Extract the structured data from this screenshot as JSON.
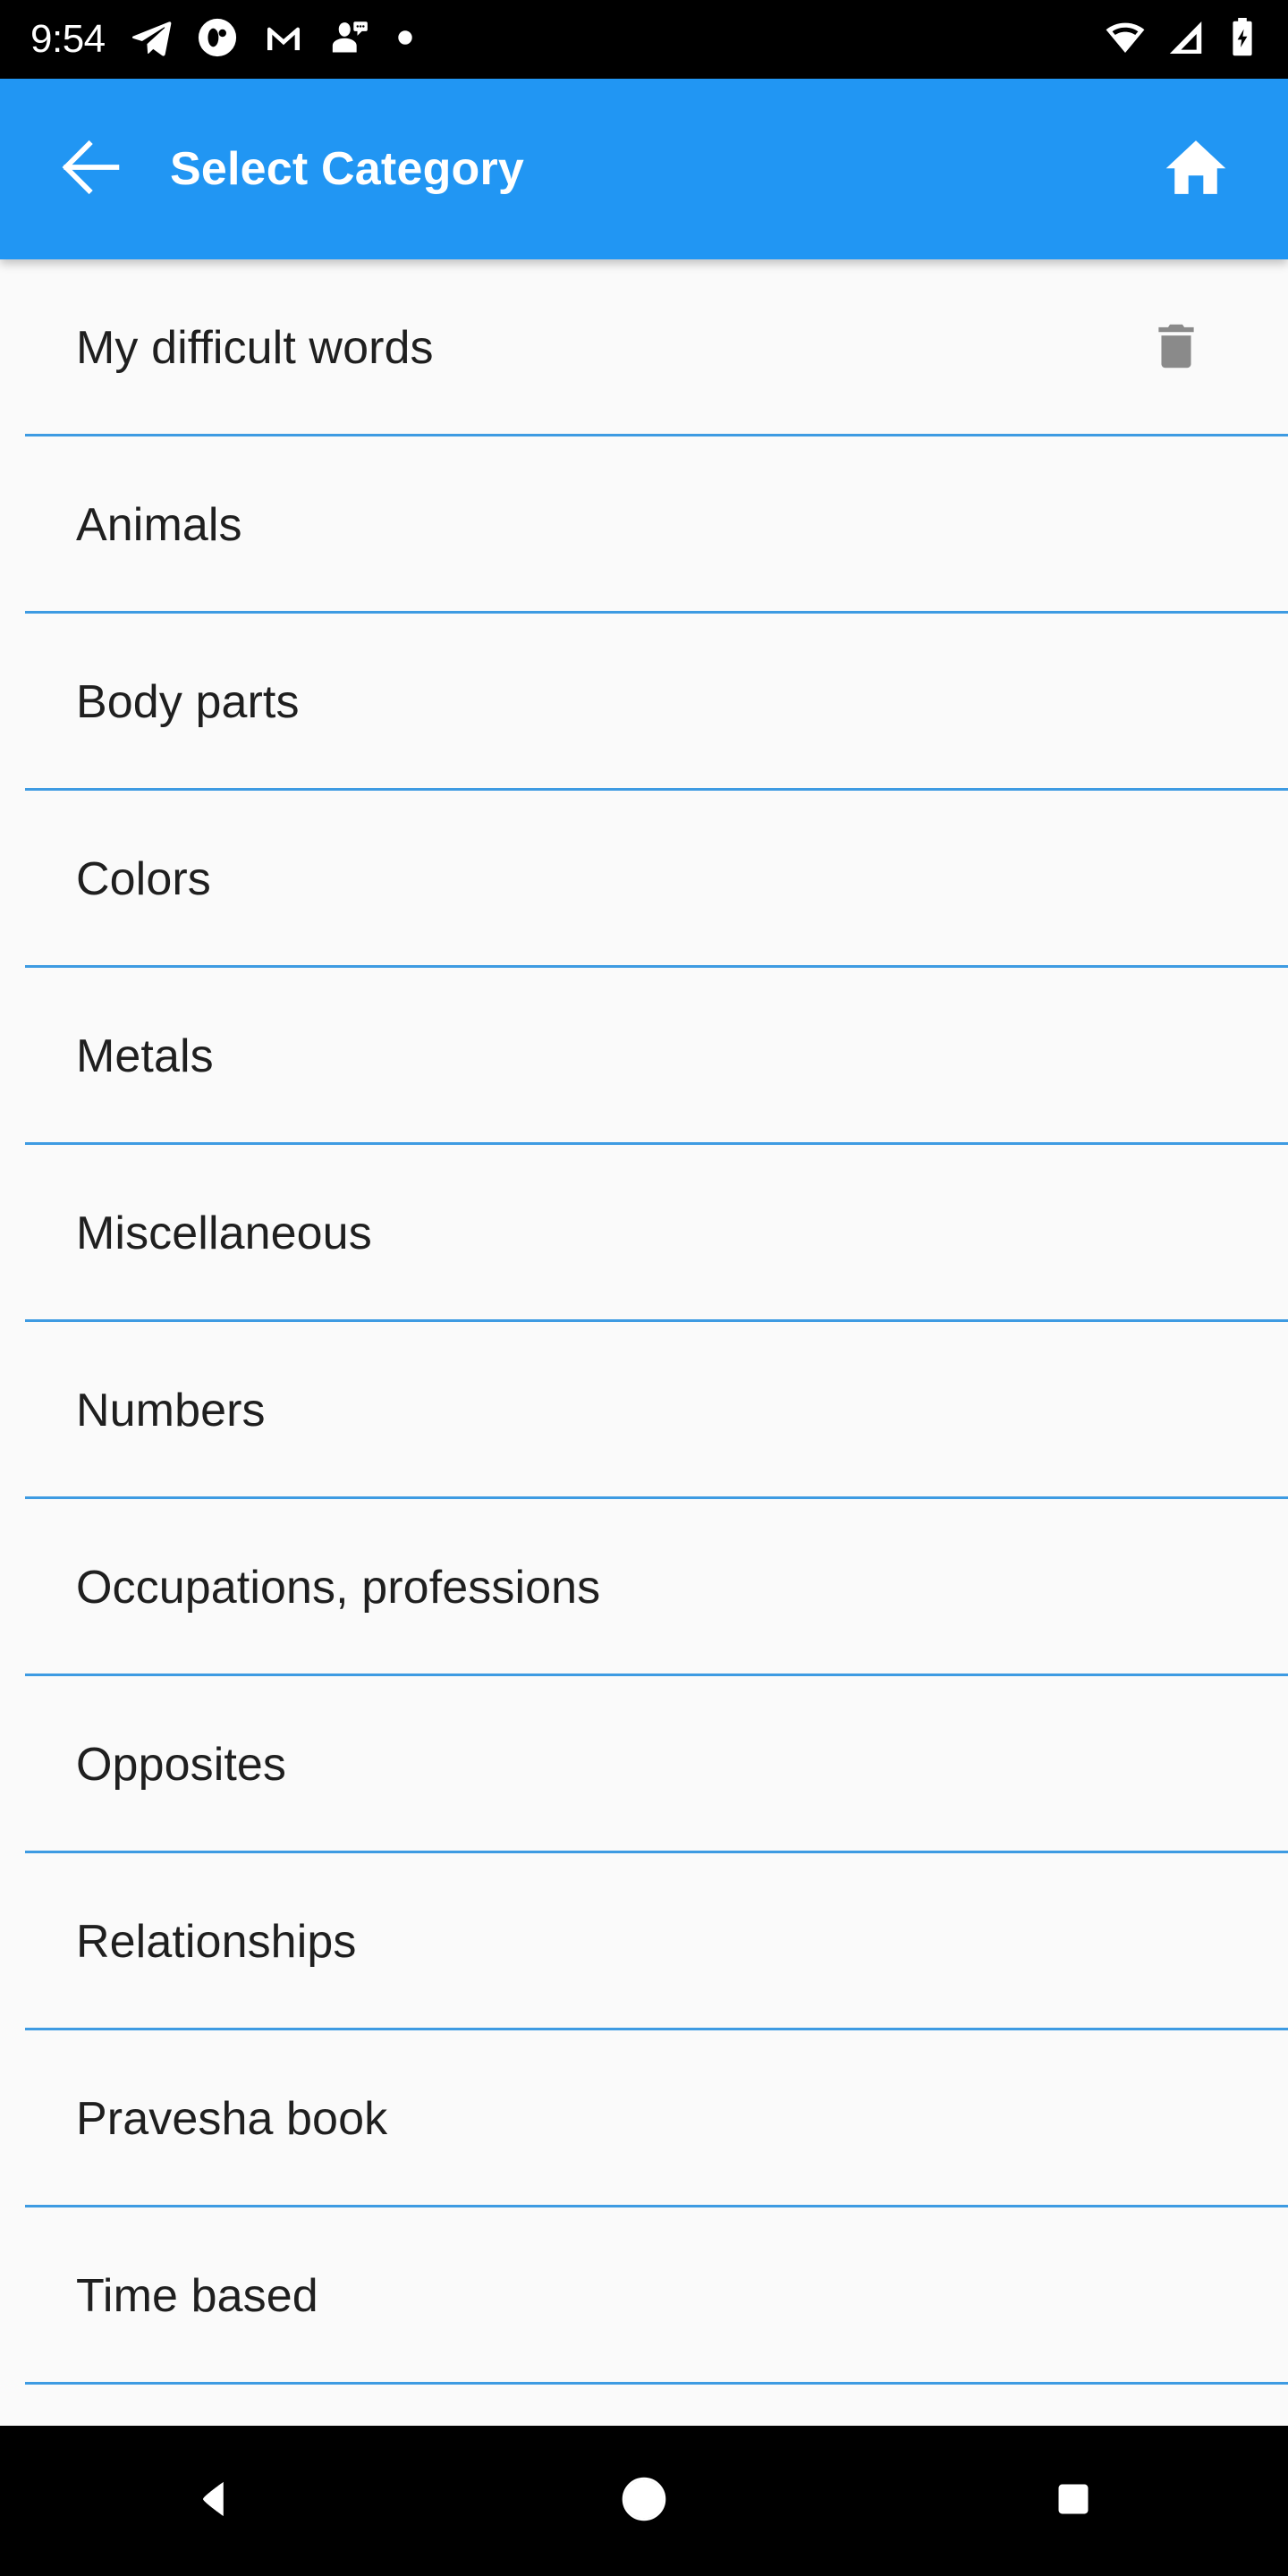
{
  "status_bar": {
    "time": "9:54",
    "notification_icons": [
      {
        "name": "telegram-icon"
      },
      {
        "name": "app-notification-icon"
      },
      {
        "name": "gmail-icon"
      },
      {
        "name": "chat-person-icon"
      },
      {
        "name": "more-notifications-dot-icon"
      }
    ],
    "system_icons": [
      {
        "name": "wifi-icon"
      },
      {
        "name": "cellular-signal-icon"
      },
      {
        "name": "battery-charging-icon"
      }
    ],
    "background_color": "#000000",
    "foreground_color": "#FFFFFF"
  },
  "app_bar": {
    "title": "Select Category",
    "back_icon": "arrow-back-icon",
    "home_icon": "home-icon",
    "background_color": "#2196F3",
    "foreground_color": "#FFFFFF"
  },
  "list": {
    "background_color": "#FAFAFA",
    "divider_color": "#3E9BE2",
    "text_color": "#1F1F1F",
    "delete_icon_color": "#8A8A8A",
    "items": [
      {
        "label": "My difficult words",
        "action_icon": "delete-trash-icon",
        "has_action": true
      },
      {
        "label": "Animals",
        "has_action": false
      },
      {
        "label": "Body parts",
        "has_action": false
      },
      {
        "label": "Colors",
        "has_action": false
      },
      {
        "label": "Metals",
        "has_action": false
      },
      {
        "label": "Miscellaneous",
        "has_action": false
      },
      {
        "label": "Numbers",
        "has_action": false
      },
      {
        "label": "Occupations, professions",
        "has_action": false
      },
      {
        "label": "Opposites",
        "has_action": false
      },
      {
        "label": "Relationships",
        "has_action": false
      },
      {
        "label": "Pravesha book",
        "has_action": false
      },
      {
        "label": "Time based",
        "has_action": false
      }
    ]
  },
  "nav_bar": {
    "background_color": "#000000",
    "buttons": [
      {
        "name": "nav-back-button",
        "icon": "triangle-back-icon"
      },
      {
        "name": "nav-home-button",
        "icon": "circle-home-icon"
      },
      {
        "name": "nav-recents-button",
        "icon": "square-recents-icon"
      }
    ]
  }
}
